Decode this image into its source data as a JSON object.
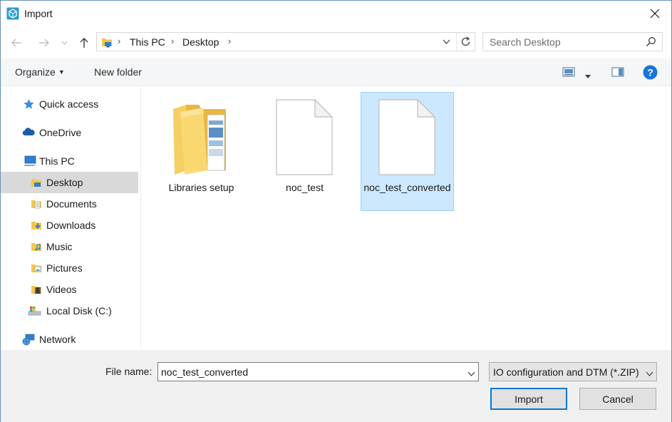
{
  "window": {
    "title": "Import"
  },
  "nav": {
    "breadcrumbs": [
      "This PC",
      "Desktop"
    ],
    "search_placeholder": "Search Desktop"
  },
  "toolbar": {
    "organize_label": "Organize",
    "new_folder_label": "New folder"
  },
  "sidebar": {
    "items": [
      {
        "label": "Quick access",
        "icon": "star-icon"
      },
      {
        "label": "OneDrive",
        "icon": "cloud-icon"
      },
      {
        "label": "This PC",
        "icon": "computer-icon"
      },
      {
        "label": "Desktop",
        "icon": "desktop-folder-icon",
        "selected": true
      },
      {
        "label": "Documents",
        "icon": "documents-folder-icon"
      },
      {
        "label": "Downloads",
        "icon": "downloads-folder-icon"
      },
      {
        "label": "Music",
        "icon": "music-folder-icon"
      },
      {
        "label": "Pictures",
        "icon": "pictures-folder-icon"
      },
      {
        "label": "Videos",
        "icon": "videos-folder-icon"
      },
      {
        "label": "Local Disk (C:)",
        "icon": "drive-icon"
      },
      {
        "label": "Network",
        "icon": "network-icon"
      }
    ]
  },
  "files": [
    {
      "name": "Libraries setup",
      "type": "folder"
    },
    {
      "name": "noc_test",
      "type": "file"
    },
    {
      "name": "noc_test_converted",
      "type": "file",
      "selected": true
    }
  ],
  "footer": {
    "file_name_label": "File name:",
    "file_name_value": "noc_test_converted",
    "filter_value": "IO configuration and DTM (*.ZIP)",
    "import_label": "Import",
    "cancel_label": "Cancel"
  },
  "colors": {
    "accent": "#0078d7",
    "selection": "#cce8ff",
    "help": "#1a73d9"
  }
}
